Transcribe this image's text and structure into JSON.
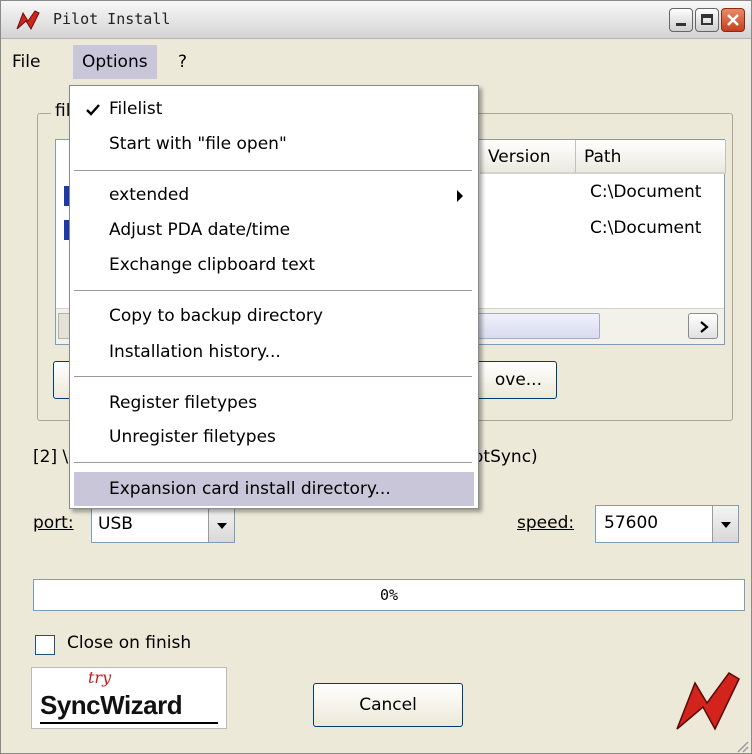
{
  "window": {
    "title": "Pilot Install",
    "accent": "#c9c6d9"
  },
  "menubar": {
    "items": [
      "File",
      "Options",
      "?"
    ]
  },
  "groupbox": {
    "label": "fil"
  },
  "list": {
    "columns": [
      "Version",
      "Path"
    ],
    "rows": [
      {
        "path": "C:\\Document"
      },
      {
        "path": "C:\\Document"
      }
    ]
  },
  "buttons": {
    "remove_partial": "ove...",
    "cancel": "Cancel"
  },
  "status": {
    "left_partial": "[2] \\",
    "right_partial": "otSync)"
  },
  "port": {
    "label": "port:",
    "value": "USB"
  },
  "speed": {
    "label": "speed:",
    "value": "57600"
  },
  "progress": {
    "text": "0%",
    "percent": 0
  },
  "close_on_finish": {
    "label": "Close on finish",
    "checked": false
  },
  "logo": {
    "small": "try",
    "big": "SyncWizard"
  },
  "options_menu": {
    "items": [
      {
        "label": "Filelist",
        "checked": true
      },
      {
        "label": "Start with \"file open\""
      },
      {
        "separator": true
      },
      {
        "label": "extended",
        "submenu": true
      },
      {
        "label": "Adjust PDA date/time"
      },
      {
        "label": "Exchange clipboard text"
      },
      {
        "separator": true
      },
      {
        "label": "Copy to backup directory"
      },
      {
        "label": "Installation history..."
      },
      {
        "separator": true
      },
      {
        "label": "Register filetypes"
      },
      {
        "label": "Unregister filetypes"
      },
      {
        "separator": true
      },
      {
        "label": "Expansion card install directory...",
        "highlighted": true
      }
    ]
  }
}
